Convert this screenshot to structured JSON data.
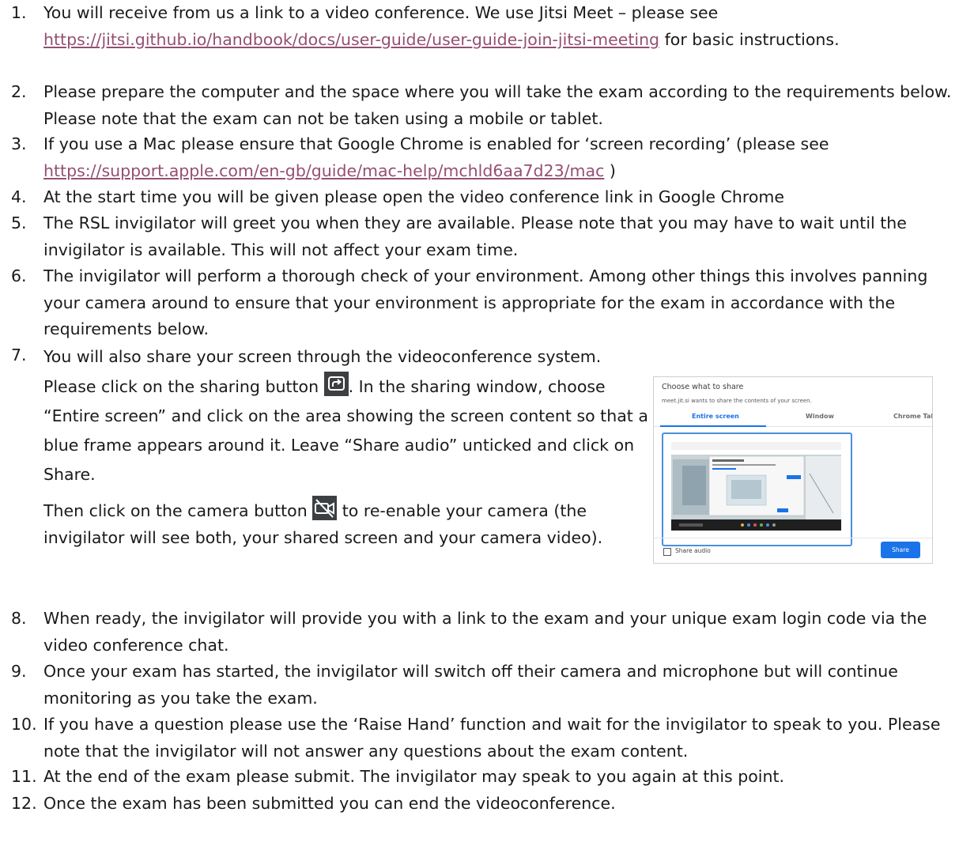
{
  "items": [
    {
      "num": "1.",
      "before": "You will receive from us a link to a video conference. We use Jitsi Meet – please see ",
      "link": "https://jitsi.github.io/handbook/docs/user-guide/user-guide-join-jitsi-meeting",
      "after": " for basic instructions."
    },
    {
      "num": "2.",
      "text": "Please prepare the computer and the space where you will take the exam according to the requirements below. Please note that the exam can not be taken using a mobile or tablet."
    },
    {
      "num": "3.",
      "before": "If you use a Mac please ensure that Google Chrome is enabled for ‘screen recording’ (please see ",
      "link": "https://support.apple.com/en-gb/guide/mac-help/mchld6aa7d23/mac",
      "after": " )"
    },
    {
      "num": "4.",
      "text": "At the start time you will be given please open the video conference link in Google Chrome"
    },
    {
      "num": "5.",
      "text": "The RSL invigilator will greet you when they are available. Please note that you may have to wait until the invigilator is available. This will not affect your exam time."
    },
    {
      "num": "6.",
      "text": "The invigilator will perform a thorough check of your environment. Among other things this involves panning your camera around to ensure that your environment is appropriate for the exam in accordance with the requirements below."
    },
    {
      "num": "7.",
      "p1_before": "You will also share your screen through the videoconference system. Please click on the sharing button ",
      "p1_after": ". In the sharing window, choose “Entire screen” and click on the area showing the screen content so that a blue frame appears around it. Leave “Share audio” unticked and click on Share.",
      "p2_before": "Then click on the camera button ",
      "p2_after": " to re-enable your camera (the invigilator will see both, your shared screen and your camera video)."
    },
    {
      "num": "8.",
      "text": "When ready, the invigilator will provide you with a link to the exam and your unique exam login code via the video conference chat."
    },
    {
      "num": "9.",
      "text": "Once your exam has started, the invigilator will switch off their camera and microphone but will continue monitoring as you take the exam."
    },
    {
      "num": "10.",
      "text": "If you have a question please use the ‘Raise Hand’ function and wait for the invigilator to speak to you. Please note that the invigilator will not answer any questions about the exam content."
    },
    {
      "num": "11.",
      "text": "At the end of the exam please submit. The invigilator may speak to you again at this point."
    },
    {
      "num": "12.",
      "text": "Once the exam has been submitted you can end the videoconference."
    }
  ],
  "share_dialog": {
    "title": "Choose what to share",
    "subtitle": "meet.jit.si wants to share the contents of your screen.",
    "tabs": [
      "Entire screen",
      "Window",
      "Chrome Tab"
    ],
    "share_audio_label": "Share audio",
    "share_button": "Share"
  },
  "colors": {
    "link": "#954f72",
    "accent": "#1a73e8",
    "icon_bg": "#3c4043"
  }
}
